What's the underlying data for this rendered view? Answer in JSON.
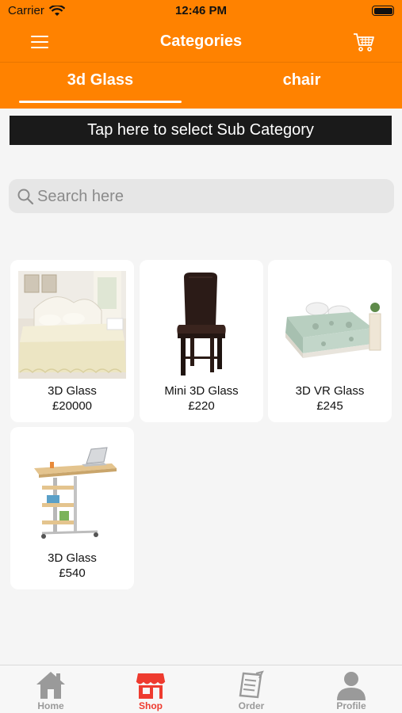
{
  "status_bar": {
    "carrier": "Carrier",
    "time": "12:46 PM"
  },
  "nav": {
    "title": "Categories",
    "menu_icon": "hamburger-menu-icon",
    "cart_icon": "shopping-cart-icon"
  },
  "tabs": [
    {
      "label": "3d Glass",
      "selected": true
    },
    {
      "label": "chair",
      "selected": false
    }
  ],
  "subcategory_button": "Tap here to select Sub Category",
  "search": {
    "placeholder": "Search here",
    "icon": "search-icon"
  },
  "products": [
    {
      "name": "3D Glass",
      "price": "£20000",
      "image": "bed-with-lace-skirt-image"
    },
    {
      "name": "Mini 3D Glass",
      "price": "£220",
      "image": "leather-dining-chair-image"
    },
    {
      "name": "3D VR Glass",
      "price": "£245",
      "image": "floral-mattress-bed-image"
    },
    {
      "name": "3D Glass",
      "price": "£540",
      "image": "laptop-side-table-image"
    }
  ],
  "bottom_nav": [
    {
      "label": "Home",
      "icon": "home-icon",
      "active": false
    },
    {
      "label": "Shop",
      "icon": "shop-icon",
      "active": true
    },
    {
      "label": "Order",
      "icon": "order-receipt-icon",
      "active": false
    },
    {
      "label": "Profile",
      "icon": "profile-icon",
      "active": false
    }
  ],
  "colors": {
    "brand": "#ff8200",
    "active_tab": "#ee3b2f",
    "inactive_tab": "#9a9a9a",
    "banner": "#1a1a1a"
  }
}
